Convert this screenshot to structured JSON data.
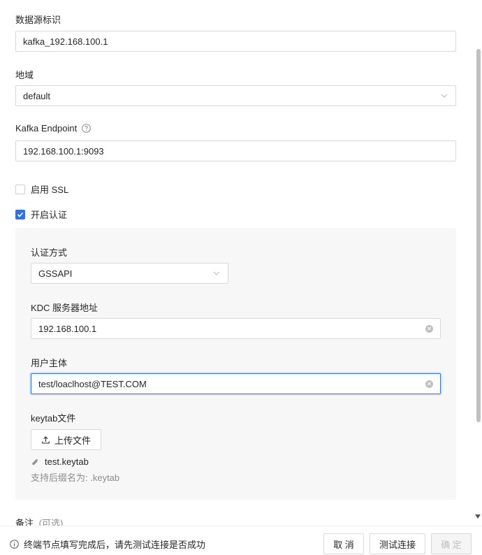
{
  "form": {
    "source_id": {
      "label": "数据源标识",
      "value": "kafka_192.168.100.1"
    },
    "region": {
      "label": "地域",
      "value": "default"
    },
    "endpoint": {
      "label": "Kafka Endpoint",
      "value": "192.168.100.1:9093"
    },
    "ssl": {
      "label": "启用 SSL",
      "checked": false
    },
    "auth": {
      "label": "开启认证",
      "checked": true
    },
    "auth_method": {
      "label": "认证方式",
      "value": "GSSAPI"
    },
    "kdc": {
      "label": "KDC 服务器地址",
      "value": "192.168.100.1"
    },
    "principal": {
      "label": "用户主体",
      "value": "test/loaclhost@TEST.COM"
    },
    "keytab": {
      "label": "keytab文件",
      "upload_label": "上传文件",
      "file_name": "test.keytab",
      "hint": "支持后缀名为: .keytab"
    },
    "remark": {
      "label": "备注",
      "optional": "(可选)"
    }
  },
  "footer": {
    "tip": "终端节点填写完成后，请先测试连接是否成功",
    "cancel_label": "取 消",
    "test_label": "测试连接",
    "confirm_label": "确 定"
  },
  "colors": {
    "accent": "#2f72e6",
    "border": "#d9d9d9",
    "panel": "#f7f7f7"
  },
  "icons": [
    "help-circle-icon",
    "chevron-down-icon",
    "checkmark-icon",
    "clear-icon",
    "upload-icon",
    "paperclip-icon",
    "info-circle-icon"
  ]
}
